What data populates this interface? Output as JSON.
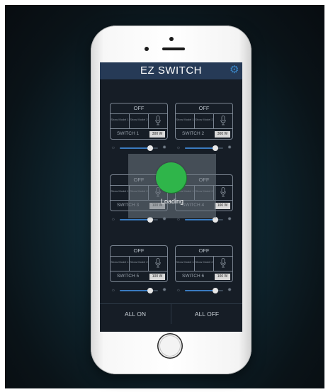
{
  "app": {
    "title": "EZ SWITCH",
    "settings_icon": "gear-icon",
    "accent": "#263a56",
    "slider_color": "#3a7bc0"
  },
  "switches": [
    {
      "status": "OFF",
      "mode1": "Show Model 1",
      "mode2": "Show Model 2",
      "name": "SWITCH 1",
      "watt": "300 W",
      "brightness": 0.8
    },
    {
      "status": "OFF",
      "mode1": "Show Model 1",
      "mode2": "Show Model 2",
      "name": "SWITCH 2",
      "watt": "300 W",
      "brightness": 0.8
    },
    {
      "status": "OFF",
      "mode1": "Show Model 1",
      "mode2": "Show Model 2",
      "name": "SWITCH 3",
      "watt": "100 W",
      "brightness": 0.8
    },
    {
      "status": "OFF",
      "mode1": "Show Model 1",
      "mode2": "Show Model 2",
      "name": "SWITCH 4",
      "watt": "100 W",
      "brightness": 0.8
    },
    {
      "status": "OFF",
      "mode1": "Show Model 1",
      "mode2": "Show Model 2",
      "name": "SWITCH 5",
      "watt": "100 W",
      "brightness": 0.8
    },
    {
      "status": "OFF",
      "mode1": "Show Model 1",
      "mode2": "Show Model 2",
      "name": "SWITCH 6",
      "watt": "100 W",
      "brightness": 0.8
    }
  ],
  "loading": {
    "text": "Loading",
    "color": "#2fb54a"
  },
  "bottom": {
    "all_on": "ALL ON",
    "all_off": "ALL OFF"
  }
}
